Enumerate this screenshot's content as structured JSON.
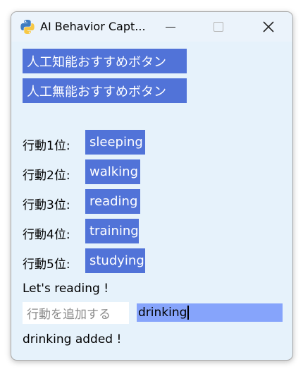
{
  "window": {
    "title": "AI Behavior Capt..."
  },
  "buttons": {
    "ai_recommend": "人工知能おすすめボタン",
    "non_ai_recommend": "人工無能おすすめボタン"
  },
  "rankings": [
    {
      "label": "行動1位:",
      "value": "sleeping"
    },
    {
      "label": "行動2位:",
      "value": "walking"
    },
    {
      "label": "行動3位:",
      "value": "reading"
    },
    {
      "label": "行動4位:",
      "value": "training"
    },
    {
      "label": "行動5位:",
      "value": "studying"
    }
  ],
  "message": "Let's reading !",
  "add_behavior": {
    "placeholder": "行動を追加する",
    "value": "drinking"
  },
  "status": "drinking added !"
}
